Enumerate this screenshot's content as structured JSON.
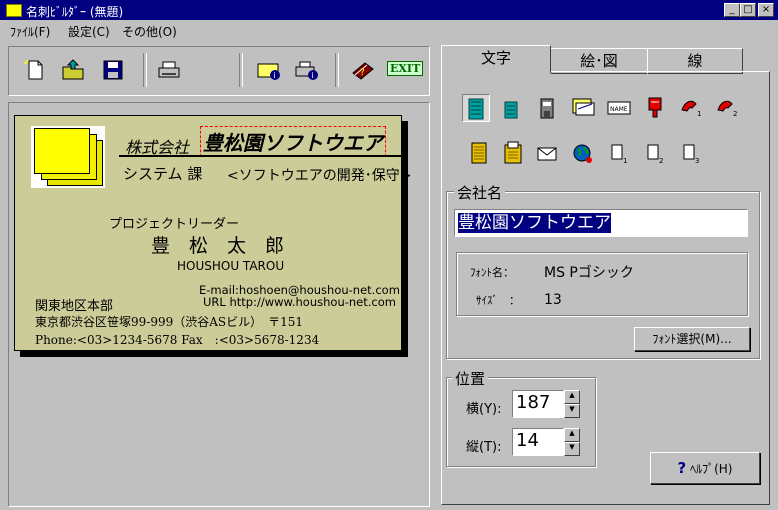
{
  "window": {
    "title": "名刺ﾋﾞﾙﾀﾞｰ (無題)",
    "controls": {
      "minimize": "_",
      "maximize": "□",
      "close": "×"
    }
  },
  "menu": [
    "ﾌｧｲﾙ(F)",
    "設定(C)",
    "その他(O)"
  ],
  "toolbar": {
    "exit_label": "EXIT"
  },
  "card": {
    "company_prefix": "株式会社",
    "company_name": "豊松園ソフトウエア",
    "department": "システム 課",
    "tagline": "<ソフトウエアの開発･保守>",
    "role": "プロジェクトリーダー",
    "person_name": "豊　松　太　郎",
    "person_romaji": "HOUSHOU TAROU",
    "email": "E-mail:hoshoen@houshou-net.com",
    "url": "URL http://www.houshou-net.com",
    "office": "関東地区本部",
    "address": "東京都渋谷区笹塚99-999（渋谷ASビル）　〒151",
    "phone": "Phone:<03>1234-5678 Fax　:<03>5678-1234"
  },
  "tabs": [
    "文字",
    "絵･図",
    "線"
  ],
  "text_panel": {
    "group_label": "会社名",
    "field_value": "豊松園ソフトウエア",
    "font_name_label": "ﾌｫﾝﾄ名：",
    "font_name_value": "MS Pゴシック",
    "font_size_label": "ｻｲｽﾞ　：",
    "font_size_value": "13",
    "font_select_button": "ﾌｫﾝﾄ選択(M)..."
  },
  "position": {
    "group_label": "位置",
    "x_label": "横(Y):",
    "x_value": "187",
    "y_label": "縦(T):",
    "y_value": "14"
  },
  "help_button": "ﾍﾙﾌﾟ(H)",
  "colors": {
    "titlebar": "#000080",
    "selection": "#000080",
    "card_bg": "#cccc99",
    "exit": "#006600"
  }
}
